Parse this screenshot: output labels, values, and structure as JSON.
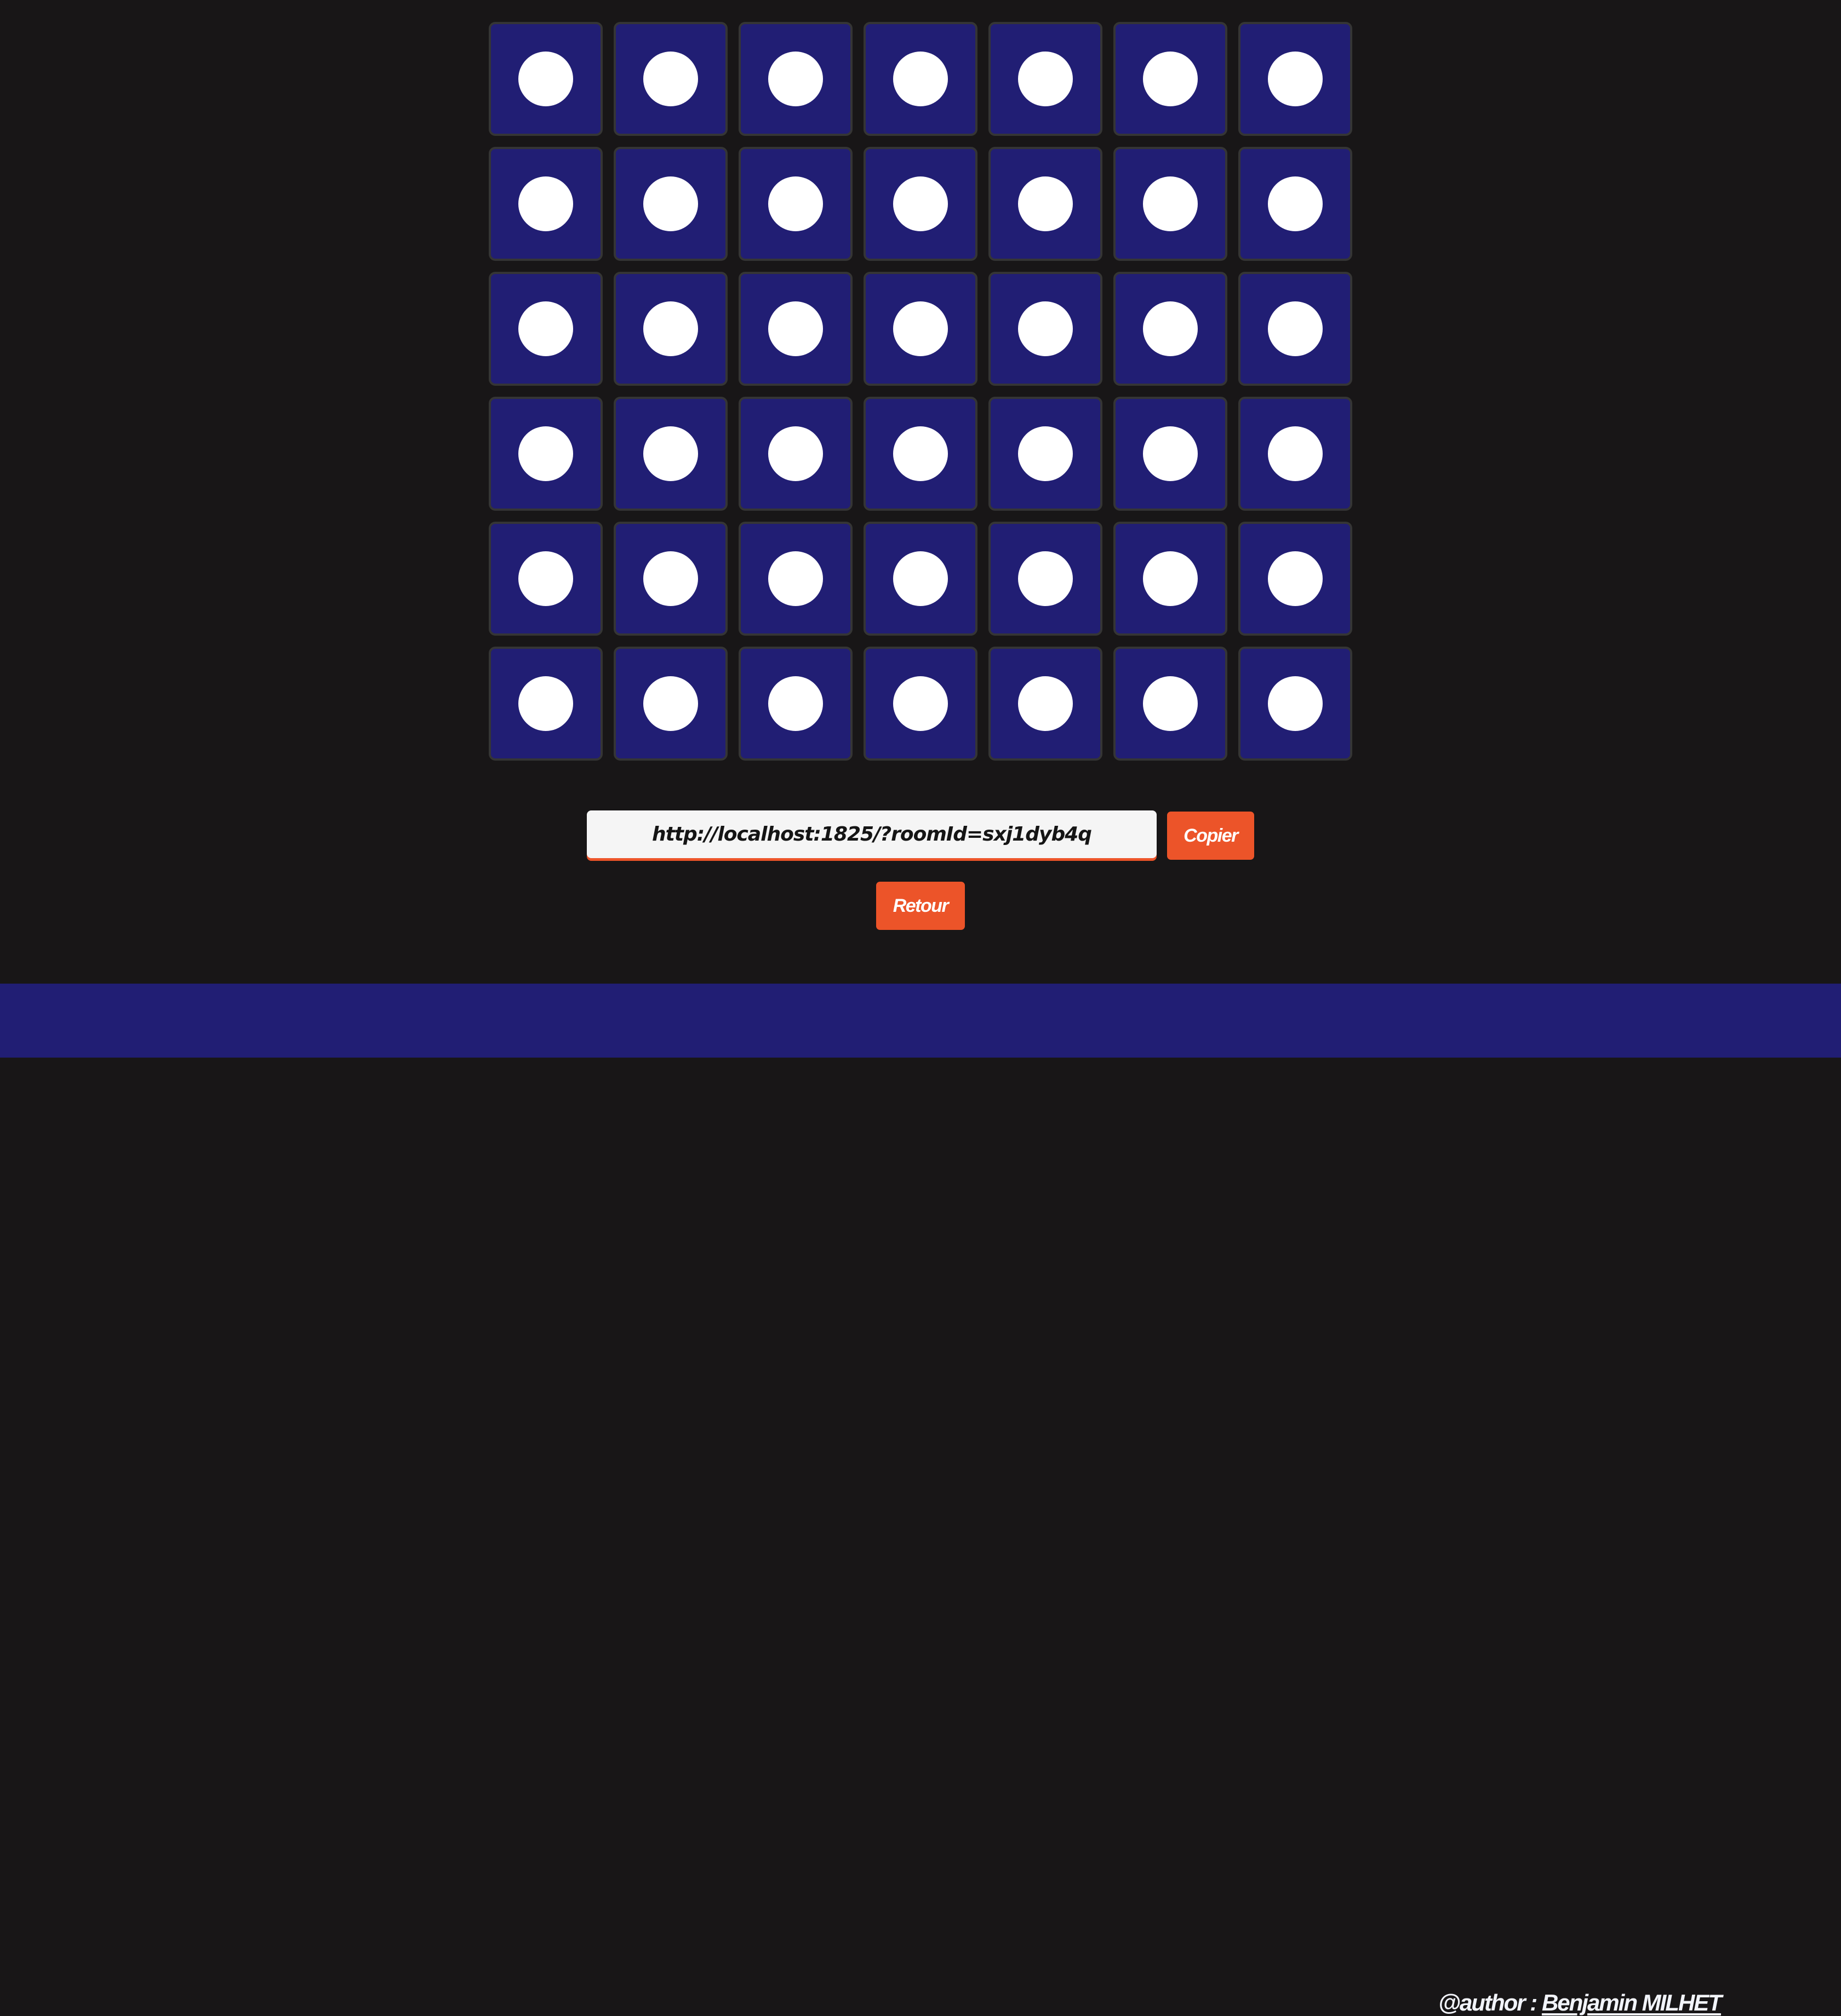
{
  "board": {
    "rows": 6,
    "columns": 7,
    "cell_color": "#211e74",
    "empty_disc_color": "#ffffff",
    "cells": [
      [
        "empty",
        "empty",
        "empty",
        "empty",
        "empty",
        "empty",
        "empty"
      ],
      [
        "empty",
        "empty",
        "empty",
        "empty",
        "empty",
        "empty",
        "empty"
      ],
      [
        "empty",
        "empty",
        "empty",
        "empty",
        "empty",
        "empty",
        "empty"
      ],
      [
        "empty",
        "empty",
        "empty",
        "empty",
        "empty",
        "empty",
        "empty"
      ],
      [
        "empty",
        "empty",
        "empty",
        "empty",
        "empty",
        "empty",
        "empty"
      ],
      [
        "empty",
        "empty",
        "empty",
        "empty",
        "empty",
        "empty",
        "empty"
      ]
    ]
  },
  "share": {
    "link_value": "http://localhost:1825/?roomId=sxj1dyb4q",
    "copy_label": "Copier"
  },
  "back_label": "Retour",
  "footer": {
    "author_prefix": "@author : ",
    "author_name": "Benjamin MILHET"
  },
  "colors": {
    "accent": "#ec5429",
    "background": "#181617",
    "footer": "#211e74"
  }
}
